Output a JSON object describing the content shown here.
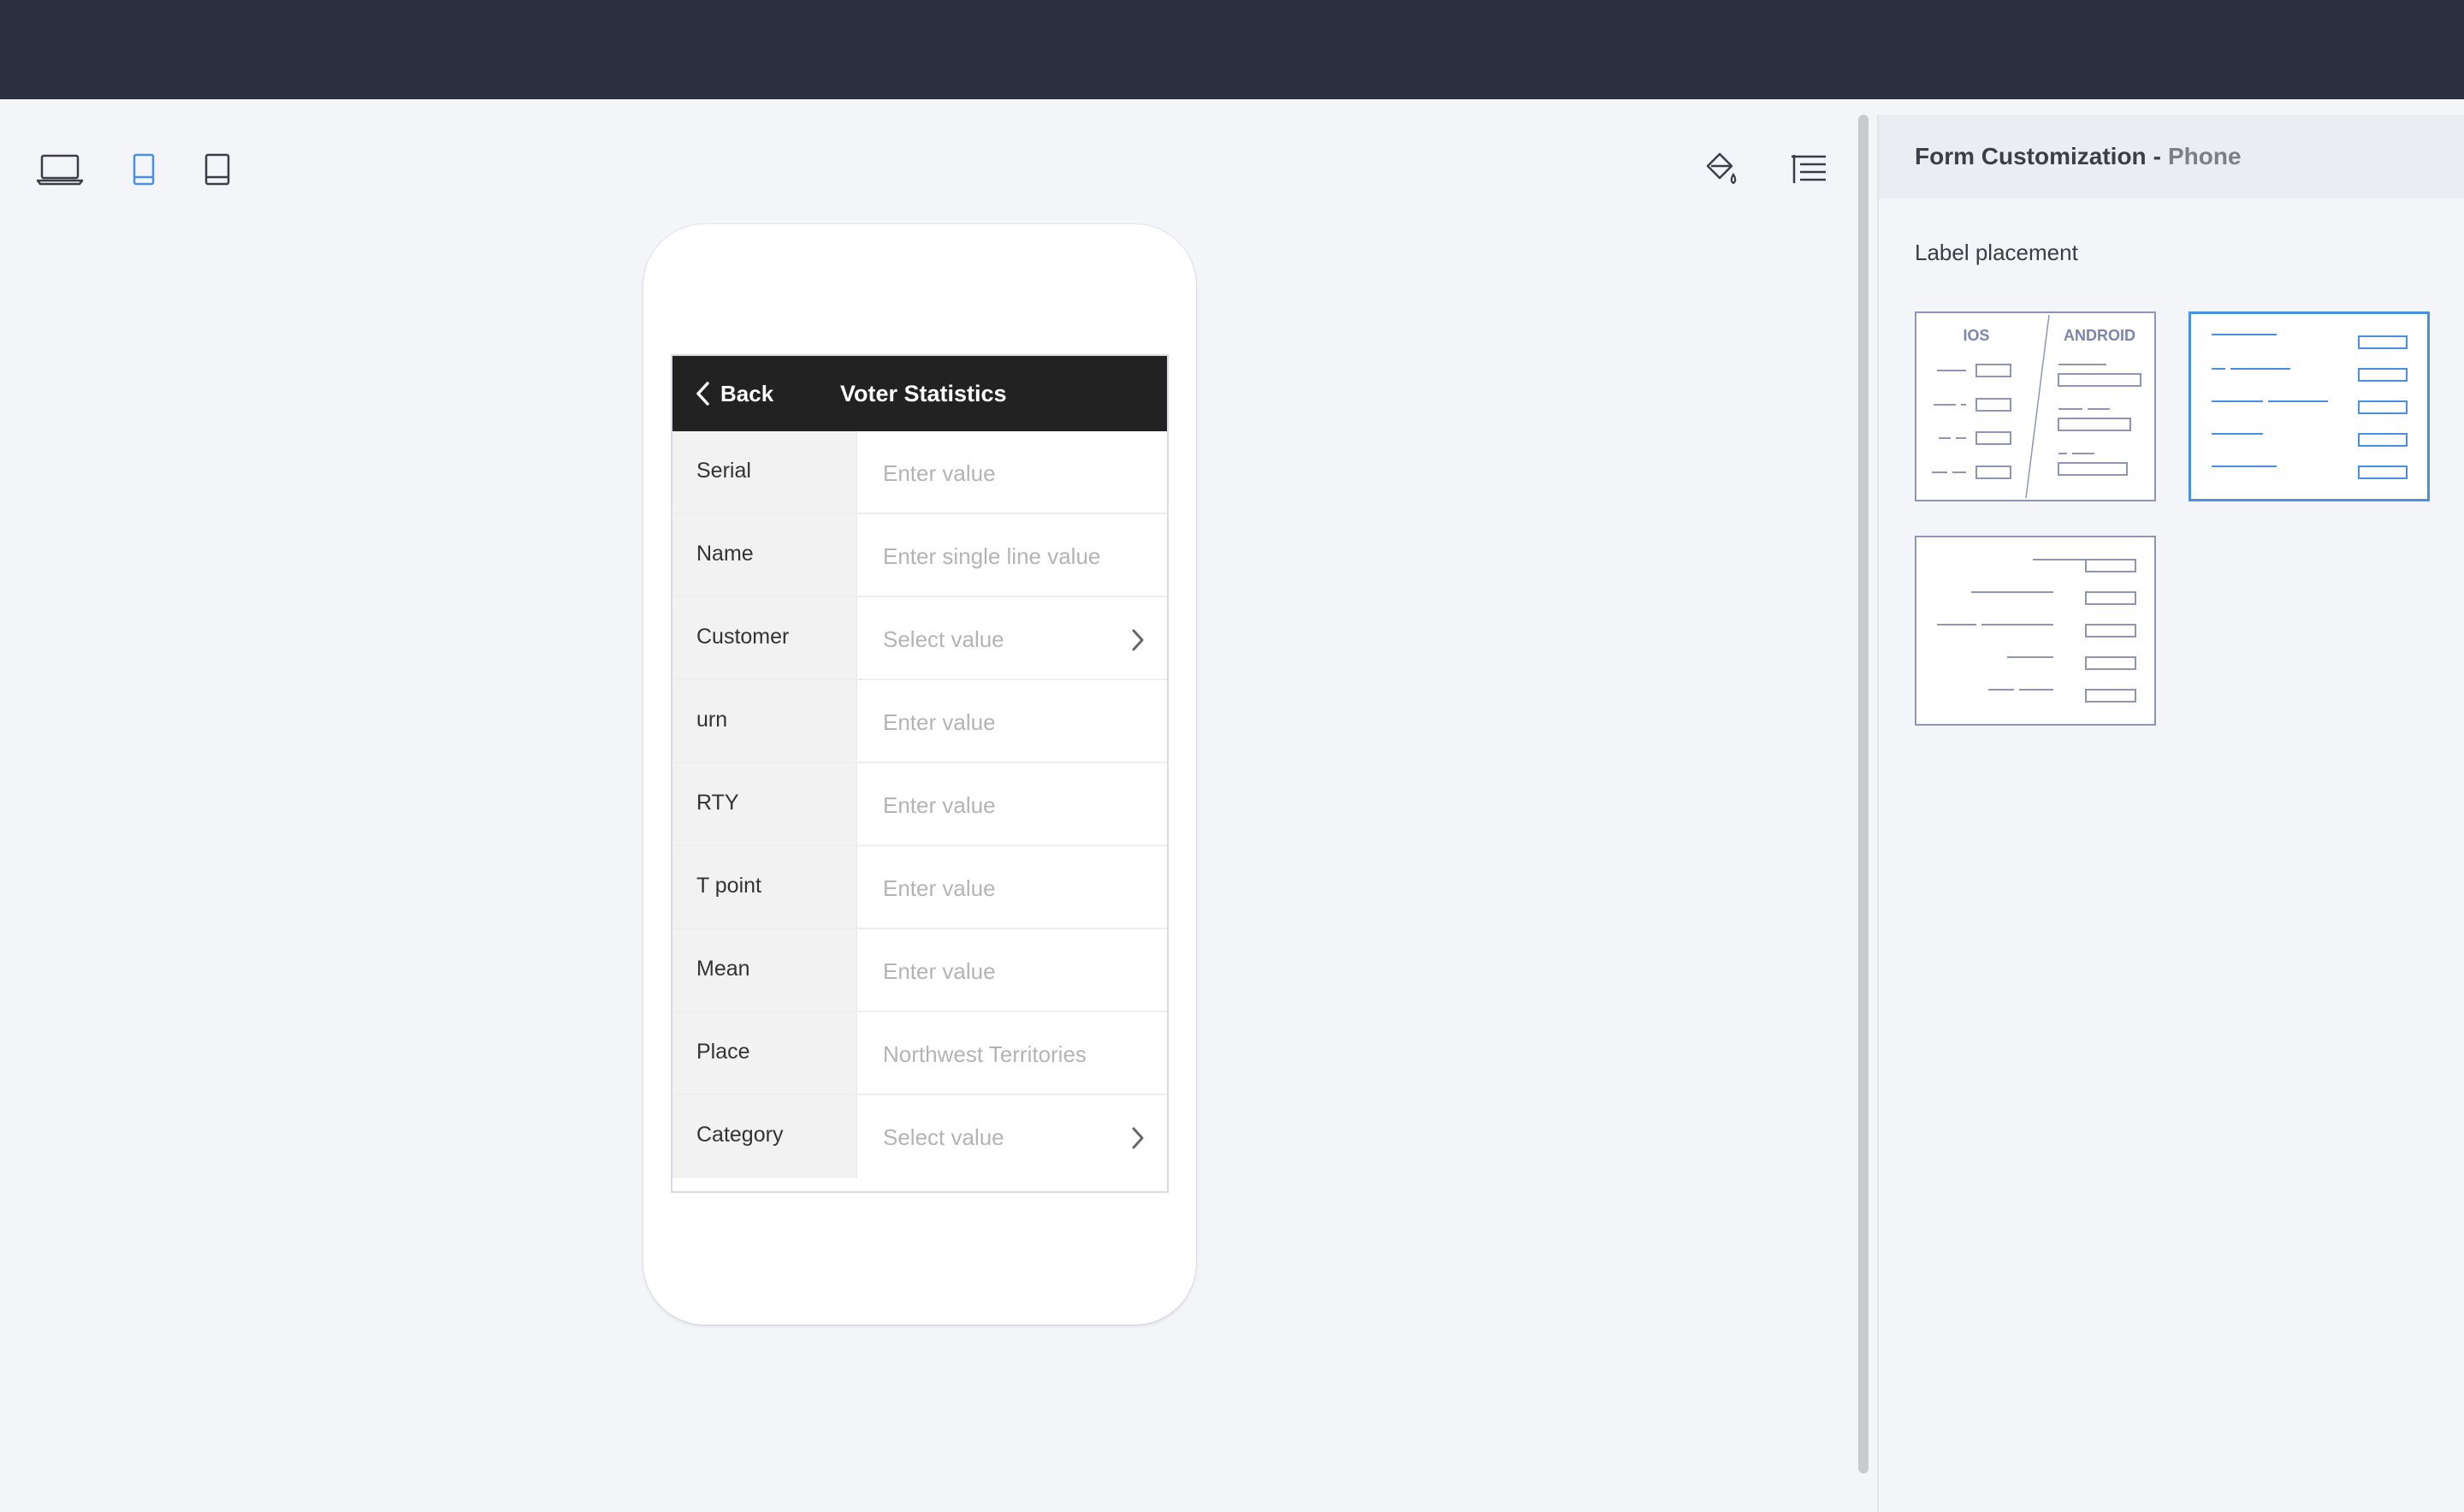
{
  "app": {
    "device_modes": [
      {
        "name": "desktop",
        "icon": "laptop-icon"
      },
      {
        "name": "phone",
        "icon": "phone-icon",
        "selected": true
      },
      {
        "name": "tablet",
        "icon": "tablet-icon"
      }
    ],
    "tools": [
      {
        "name": "theme",
        "icon": "paint-bucket-icon"
      },
      {
        "name": "layout",
        "icon": "list-settings-icon"
      }
    ],
    "accent_color": "#4a90e2",
    "topbar_color": "#2b3040"
  },
  "phone": {
    "navbar": {
      "back_label": "Back",
      "title": "Voter Statistics"
    },
    "fields": [
      {
        "label": "Serial",
        "placeholder": "Enter value",
        "picker": false
      },
      {
        "label": "Name",
        "placeholder": "Enter single line value",
        "picker": false
      },
      {
        "label": "Customer",
        "placeholder": "Select value",
        "picker": true
      },
      {
        "label": "urn",
        "placeholder": "Enter value",
        "picker": false
      },
      {
        "label": "RTY",
        "placeholder": "Enter value",
        "picker": false
      },
      {
        "label": "T point",
        "placeholder": "Enter value",
        "picker": false
      },
      {
        "label": "Mean",
        "placeholder": "Enter value",
        "picker": false
      },
      {
        "label": "Place",
        "placeholder": "Northwest Territories",
        "picker": false
      },
      {
        "label": "Category",
        "placeholder": "Select value",
        "picker": true
      }
    ]
  },
  "panel": {
    "title": "Form Customization",
    "separator": "-",
    "subtitle": "Phone",
    "section_label": "Label placement",
    "options": [
      {
        "name": "platform-default",
        "ios_label": "IOS",
        "android_label": "ANDROID",
        "selected": false
      },
      {
        "name": "left-aligned",
        "selected": true
      },
      {
        "name": "right-aligned",
        "selected": false
      }
    ]
  }
}
